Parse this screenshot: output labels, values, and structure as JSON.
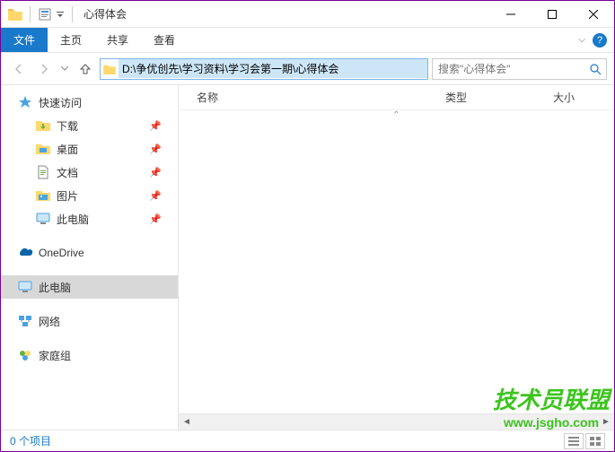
{
  "titlebar": {
    "title": "心得体会"
  },
  "ribbon": {
    "file": "文件",
    "home": "主页",
    "share": "共享",
    "view": "查看"
  },
  "nav": {
    "path": "D:\\争优创先\\学习资料\\学习会第一期\\心得体会",
    "search_placeholder": "搜索\"心得体会\""
  },
  "columns": {
    "name": "名称",
    "type": "类型",
    "size": "大小"
  },
  "sidebar": {
    "quick_access": "快速访问",
    "downloads": "下载",
    "desktop": "桌面",
    "documents": "文档",
    "pictures": "图片",
    "this_pc_qa": "此电脑",
    "onedrive": "OneDrive",
    "this_pc": "此电脑",
    "network": "网络",
    "homegroup": "家庭组"
  },
  "status": {
    "items": "0 个项目"
  },
  "watermark": {
    "text": "技术员联盟",
    "url": "www.jsgho.com"
  }
}
